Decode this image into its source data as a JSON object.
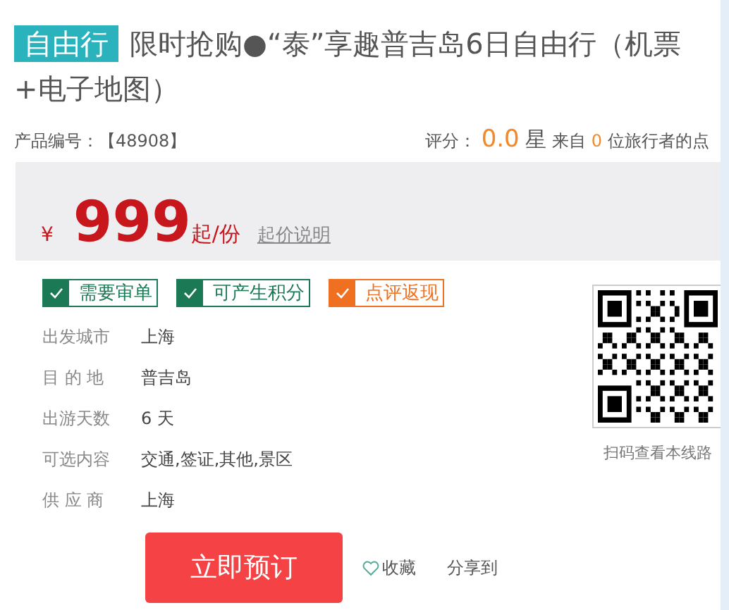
{
  "header": {
    "badge": "自由行",
    "title_lines": [
      "限时抢购●“泰”享趣普吉岛6日自由行（机票",
      "+电子地图）"
    ]
  },
  "meta": {
    "product_no_label": "产品编号：",
    "product_no": "【48908】",
    "rating_label": "评分：",
    "rating": "0.0",
    "rating_unit": "星",
    "from": "来自",
    "reviewer_count": "0",
    "reviewers_suffix": "位旅行者的点"
  },
  "price": {
    "currency": "¥",
    "amount": "999",
    "unit": "起/份",
    "note_link": "起价说明"
  },
  "tags": [
    {
      "label": "需要审单",
      "color": "#1b7a55"
    },
    {
      "label": "可产生积分",
      "color": "#1b7a55"
    },
    {
      "label": "点评返现",
      "color": "#f07022"
    }
  ],
  "details": [
    {
      "label": "出发城市",
      "value": "上海"
    },
    {
      "label": "目 的 地",
      "value": "普吉岛"
    },
    {
      "label": "出游天数",
      "value": "6 天"
    },
    {
      "label": "可选内容",
      "value": "交通,签证,其他,景区"
    },
    {
      "label": "供 应 商",
      "value": "上海"
    }
  ],
  "qr": {
    "caption": "扫码查看本线路"
  },
  "actions": {
    "book": "立即预订",
    "favorite": "收藏",
    "share": "分享到"
  }
}
